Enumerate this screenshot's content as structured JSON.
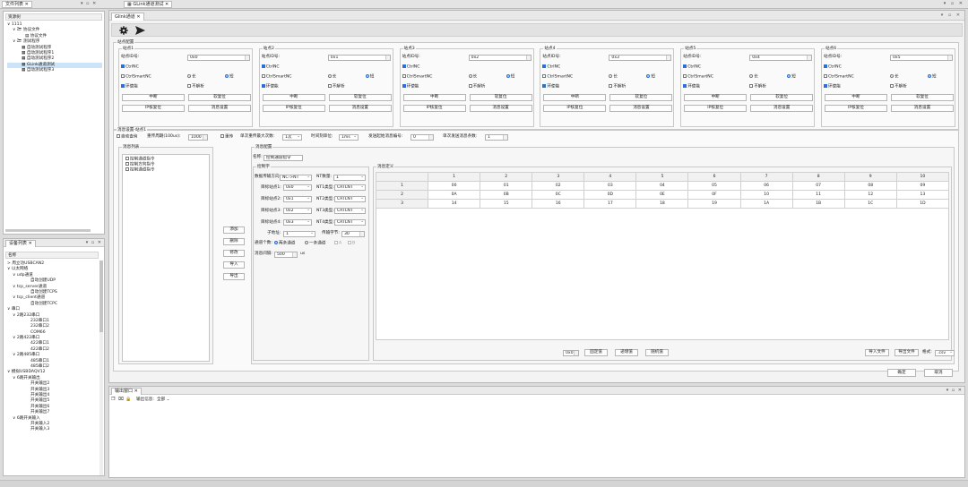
{
  "titlebar": {
    "file_tab": "文件列表",
    "main_tab": "GLink通道测试"
  },
  "file_panel": {
    "header": "资源树",
    "items": [
      {
        "label": "1111"
      },
      {
        "label": "协议文件"
      },
      {
        "label": "协议文件"
      },
      {
        "label": "测试程序"
      },
      {
        "label": "自动测试程序"
      },
      {
        "label": "自动测试程序1"
      },
      {
        "label": "自动测试程序2"
      },
      {
        "label": "GLink通道测试"
      },
      {
        "label": "自动测试程序3"
      }
    ]
  },
  "device_panel": {
    "tab": "设备列表",
    "header": "名称",
    "items": [
      {
        "label": "周立功USBCAN2"
      },
      {
        "label": "以太网络"
      },
      {
        "label": "udp通道"
      },
      {
        "label": "自动创建UDP"
      },
      {
        "label": "tcp_server通道"
      },
      {
        "label": "自动创建TCPS"
      },
      {
        "label": "tcp_client通道"
      },
      {
        "label": "自动创建TCPC"
      },
      {
        "label": "串口"
      },
      {
        "label": "2路232串口"
      },
      {
        "label": "232串口1"
      },
      {
        "label": "232串口2"
      },
      {
        "label": "COM66"
      },
      {
        "label": "2路422串口"
      },
      {
        "label": "422串口1"
      },
      {
        "label": "422串口2"
      },
      {
        "label": "2路485串口"
      },
      {
        "label": "485串口1"
      },
      {
        "label": "485串口2"
      },
      {
        "label": "模拟USBDAQV12"
      },
      {
        "label": "6路开关输出"
      },
      {
        "label": "开关输出2"
      },
      {
        "label": "开关输出3"
      },
      {
        "label": "开关输出4"
      },
      {
        "label": "开关输出5"
      },
      {
        "label": "开关输出6"
      },
      {
        "label": "开关输出7"
      },
      {
        "label": "6路开关输入"
      },
      {
        "label": "开关输入2"
      },
      {
        "label": "开关输入3"
      }
    ]
  },
  "inner_tab": "Glink通道",
  "station_group": {
    "title": "站点配置",
    "id_label": "站点ID号:",
    "ctrlnc": "CtrlNC",
    "ctrlsmartnc": "CtrlSmartNC",
    "long": "长",
    "short": "短",
    "loop": "环使能",
    "noparse": "不解析",
    "btn_interrupt": "中断",
    "btn_soft_reset": "软复位",
    "btn_ip_reset": "IP核复位",
    "btn_msg_set": "消息设置",
    "stations": [
      {
        "name": "站点1",
        "id": "0x0"
      },
      {
        "name": "站点2",
        "id": "0x1"
      },
      {
        "name": "站点3",
        "id": "0x2"
      },
      {
        "name": "站点4",
        "id": "0x3"
      },
      {
        "name": "站点5",
        "id": "0x4"
      },
      {
        "name": "站点6",
        "id": "0x5"
      }
    ]
  },
  "message_settings": {
    "title": "消息设置-站点1",
    "auto_send": "自动查询",
    "resend_period_label": "重传周期(100us):",
    "resend_period": "1000",
    "resend": "重传",
    "max_resend_label": "单次重传最大次数:",
    "max_resend": "1次",
    "time_unit_label": "时间刻单位:",
    "time_unit": "1ms",
    "start_msg_label": "发送起始消息编号:",
    "start_msg": "0",
    "single_send_label": "单次发送消息条数:",
    "single_send": "1"
  },
  "message_list": {
    "title": "消息列表",
    "items": [
      {
        "label": "控制通道指令"
      },
      {
        "label": "控制方向指令"
      },
      {
        "label": "控制通道指令"
      }
    ],
    "buttons": {
      "add": "添加",
      "delete": "删除",
      "modify": "修改",
      "import": "导入",
      "export": "导出"
    }
  },
  "message_config": {
    "title": "消息配置",
    "name_label": "名称:",
    "name_value": "控制通道指令",
    "control_word": {
      "title": "控制字",
      "direction_label": "数据传输方向:",
      "direction_value": "NC->NT",
      "nt_count_label": "NT数量:",
      "nt_count": "1",
      "targets": [
        {
          "label": "目标站点1:",
          "value": "0x0",
          "type_label": "NT1类型:",
          "type": "CRTLNT"
        },
        {
          "label": "目标站点2:",
          "value": "0x1",
          "type_label": "NT2类型:",
          "type": "CRTLNT"
        },
        {
          "label": "目标站点3:",
          "value": "0x2",
          "type_label": "NT3类型:",
          "type": "CRTLNT"
        },
        {
          "label": "目标站点4:",
          "value": "0x3",
          "type_label": "NT4类型:",
          "type": "CRTLNT"
        }
      ],
      "sub_addr_label": "子地址:",
      "sub_addr": "1",
      "bytes_label": "传输字节:",
      "bytes": "30",
      "channel_count_label": "通道个数:",
      "two_channel": "两条通道",
      "one_channel": "一条通道",
      "ch_a": "A",
      "ch_b": "B",
      "interval_label": "消息间隔:",
      "interval": "500",
      "interval_unit": "us"
    }
  },
  "message_def": {
    "title": "消息定义",
    "columns": [
      "1",
      "2",
      "3",
      "4",
      "5",
      "6",
      "7",
      "8",
      "9",
      "10"
    ],
    "rows": [
      {
        "num": "1",
        "cells": [
          "00",
          "01",
          "02",
          "03",
          "04",
          "05",
          "06",
          "07",
          "08",
          "09"
        ]
      },
      {
        "num": "2",
        "cells": [
          "0A",
          "0B",
          "0C",
          "0D",
          "0E",
          "0F",
          "10",
          "11",
          "12",
          "13"
        ]
      },
      {
        "num": "3",
        "cells": [
          "14",
          "15",
          "16",
          "17",
          "18",
          "19",
          "1A",
          "1B",
          "1C",
          "1D"
        ]
      }
    ],
    "fill_value": "0x0",
    "btn_fixed": "固定值",
    "btn_increment": "递增值",
    "btn_random": "随机值",
    "btn_import": "导入文件",
    "btn_export": "导出文件",
    "format_label": "格式:",
    "format_value": ".csv"
  },
  "dialog_buttons": {
    "ok": "确定",
    "cancel": "取消"
  },
  "output_panel": {
    "tab": "输出窗口",
    "info_label": "输出信息:",
    "info_value": "全部"
  }
}
